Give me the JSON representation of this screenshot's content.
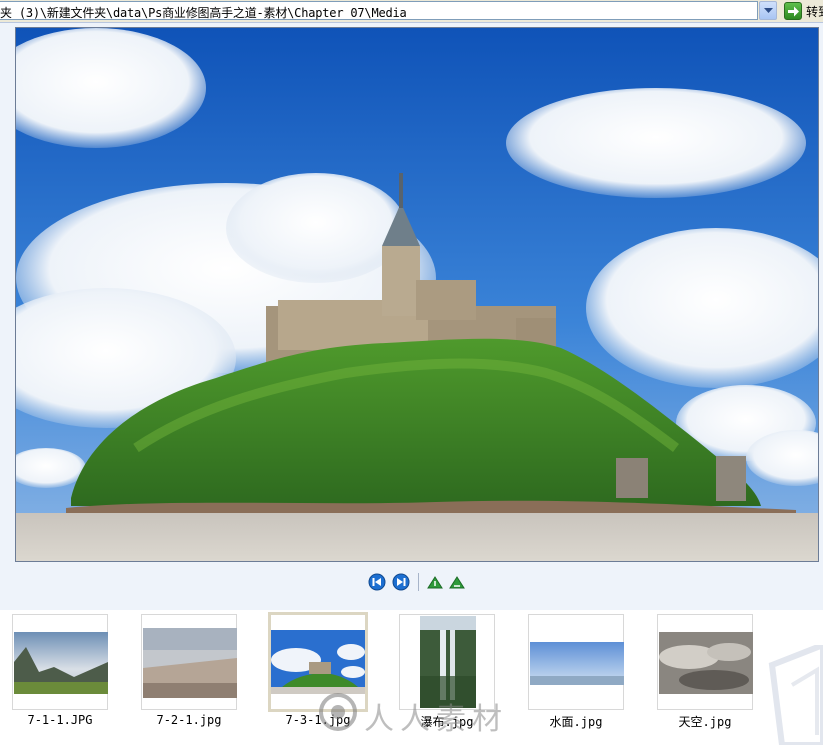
{
  "address_bar": {
    "path": "夹 (3)\\新建文件夹\\data\\Ps商业修图高手之道-素材\\Chapter 07\\Media",
    "go_label": "转到"
  },
  "icons": {
    "dropdown": "chevron-down-icon",
    "go": "go-arrow-icon",
    "prev": "previous-image-icon",
    "next": "next-image-icon",
    "rotate_cw": "rotate-clockwise-icon",
    "rotate_ccw": "rotate-counterclockwise-icon"
  },
  "viewer": {
    "selected_file": "7-3-1.jpg"
  },
  "thumbnails": [
    {
      "name": "7-1-1.JPG",
      "selected": false
    },
    {
      "name": "7-2-1.jpg",
      "selected": false
    },
    {
      "name": "7-3-1.jpg",
      "selected": true
    },
    {
      "name": "瀑布.jpg",
      "selected": false
    },
    {
      "name": "水面.jpg",
      "selected": false
    },
    {
      "name": "天空.jpg",
      "selected": false
    }
  ],
  "watermark": {
    "text": "人人素材"
  },
  "colors": {
    "viewer_bg": "#eef3fa",
    "go_green": "#2e8a22",
    "nav_blue": "#1d6fd1"
  }
}
